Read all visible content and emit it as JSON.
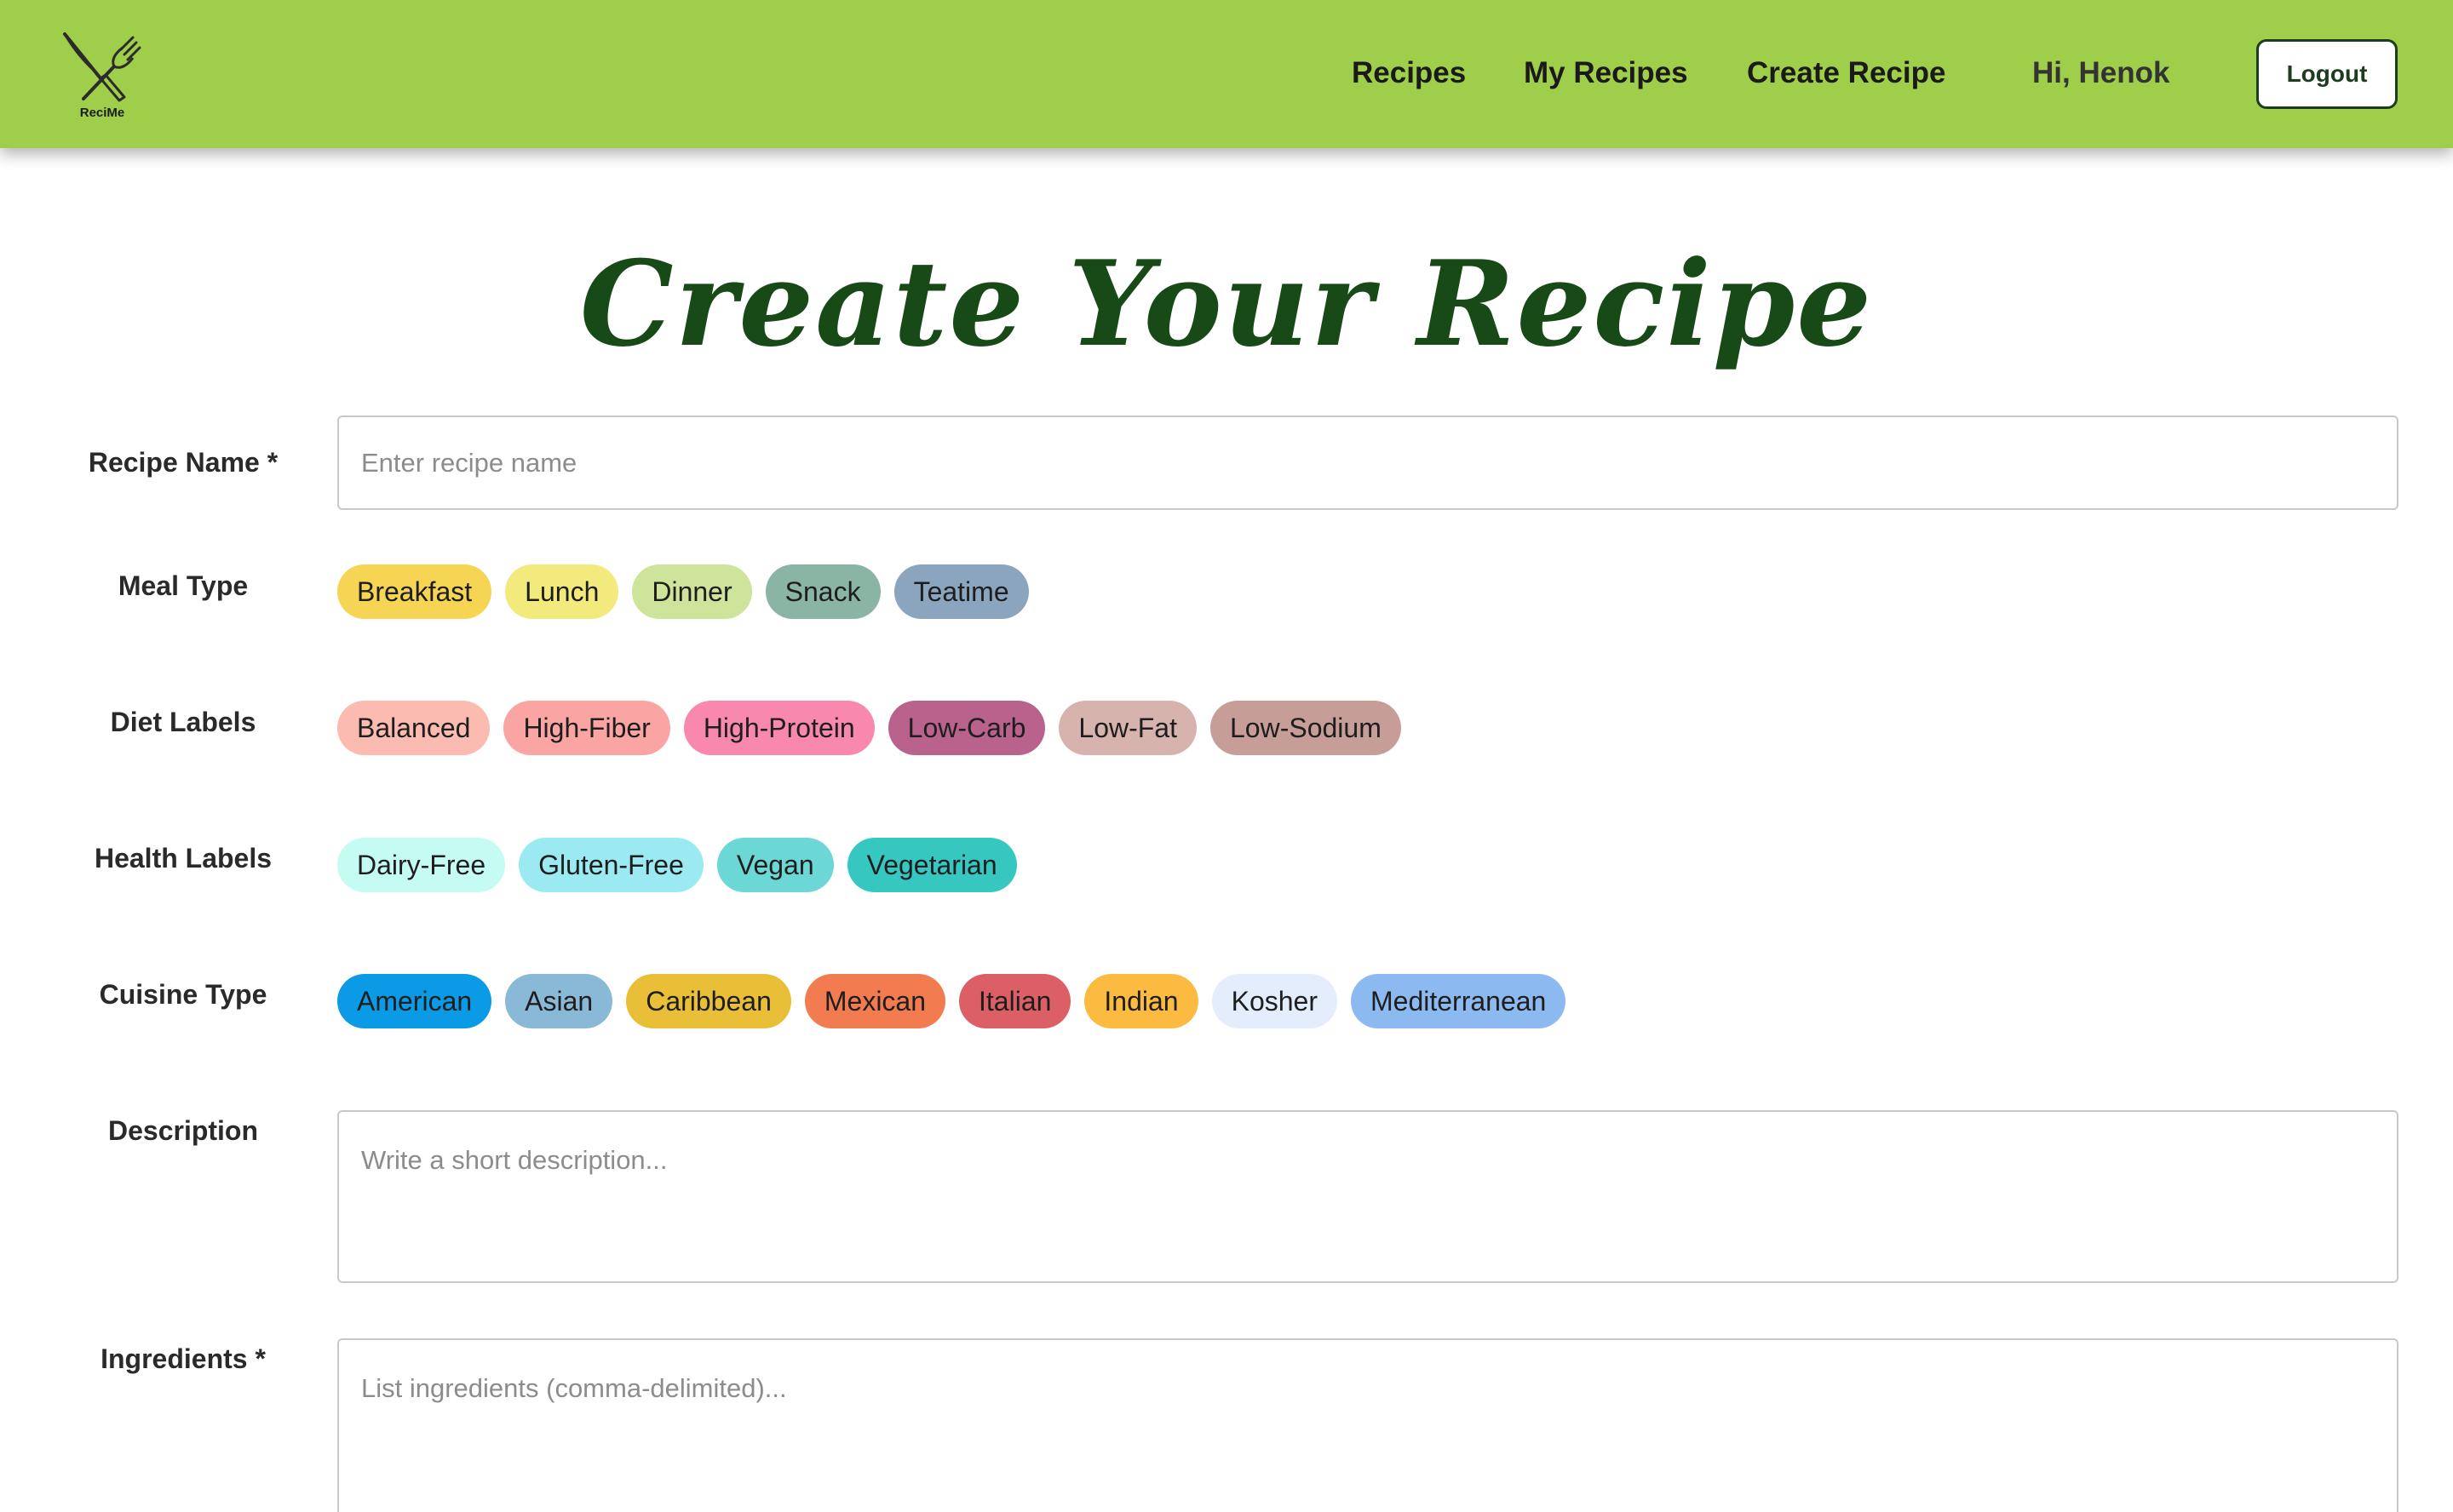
{
  "brand": {
    "logo_text": "ReciMe"
  },
  "nav": {
    "links": [
      "Recipes",
      "My Recipes",
      "Create Recipe"
    ],
    "greeting": "Hi, Henok",
    "logout_label": "Logout"
  },
  "page_title": "Create Your Recipe",
  "form": {
    "recipe_name": {
      "label": "Recipe Name *",
      "placeholder": "Enter recipe name",
      "value": ""
    },
    "meal_type": {
      "label": "Meal Type",
      "options": [
        {
          "label": "Breakfast",
          "color": "#f5d553"
        },
        {
          "label": "Lunch",
          "color": "#f3ea7e"
        },
        {
          "label": "Dinner",
          "color": "#cde49a"
        },
        {
          "label": "Snack",
          "color": "#8ab5a5"
        },
        {
          "label": "Teatime",
          "color": "#8aa5bd"
        }
      ]
    },
    "diet_labels": {
      "label": "Diet Labels",
      "options": [
        {
          "label": "Balanced",
          "color": "#fbbbb0"
        },
        {
          "label": "High-Fiber",
          "color": "#fba4a4"
        },
        {
          "label": "High-Protein",
          "color": "#f888ad"
        },
        {
          "label": "Low-Carb",
          "color": "#b9628c"
        },
        {
          "label": "Low-Fat",
          "color": "#d6b3ad"
        },
        {
          "label": "Low-Sodium",
          "color": "#c79d98"
        }
      ]
    },
    "health_labels": {
      "label": "Health Labels",
      "options": [
        {
          "label": "Dairy-Free",
          "color": "#c6fbf4"
        },
        {
          "label": "Gluten-Free",
          "color": "#9ceaf1"
        },
        {
          "label": "Vegan",
          "color": "#6cd8d6"
        },
        {
          "label": "Vegetarian",
          "color": "#36c7c0"
        }
      ]
    },
    "cuisine_type": {
      "label": "Cuisine Type",
      "options": [
        {
          "label": "American",
          "color": "#0b9ae6"
        },
        {
          "label": "Asian",
          "color": "#8ab9d8"
        },
        {
          "label": "Caribbean",
          "color": "#e9bf38"
        },
        {
          "label": "Mexican",
          "color": "#f27b4f"
        },
        {
          "label": "Italian",
          "color": "#dc5f65"
        },
        {
          "label": "Indian",
          "color": "#fbbb40"
        },
        {
          "label": "Kosher",
          "color": "#e4edfb"
        },
        {
          "label": "Mediterranean",
          "color": "#8cbaf0"
        }
      ]
    },
    "description": {
      "label": "Description",
      "placeholder": "Write a short description...",
      "value": ""
    },
    "ingredients": {
      "label": "Ingredients *",
      "placeholder": "List ingredients (comma-delimited)...",
      "value": ""
    }
  },
  "icons": {
    "logo": "fork-knife-icon"
  },
  "colors": {
    "navbar": "#9fce4a",
    "title": "#184a18",
    "logout_border": "#1e3d20"
  }
}
